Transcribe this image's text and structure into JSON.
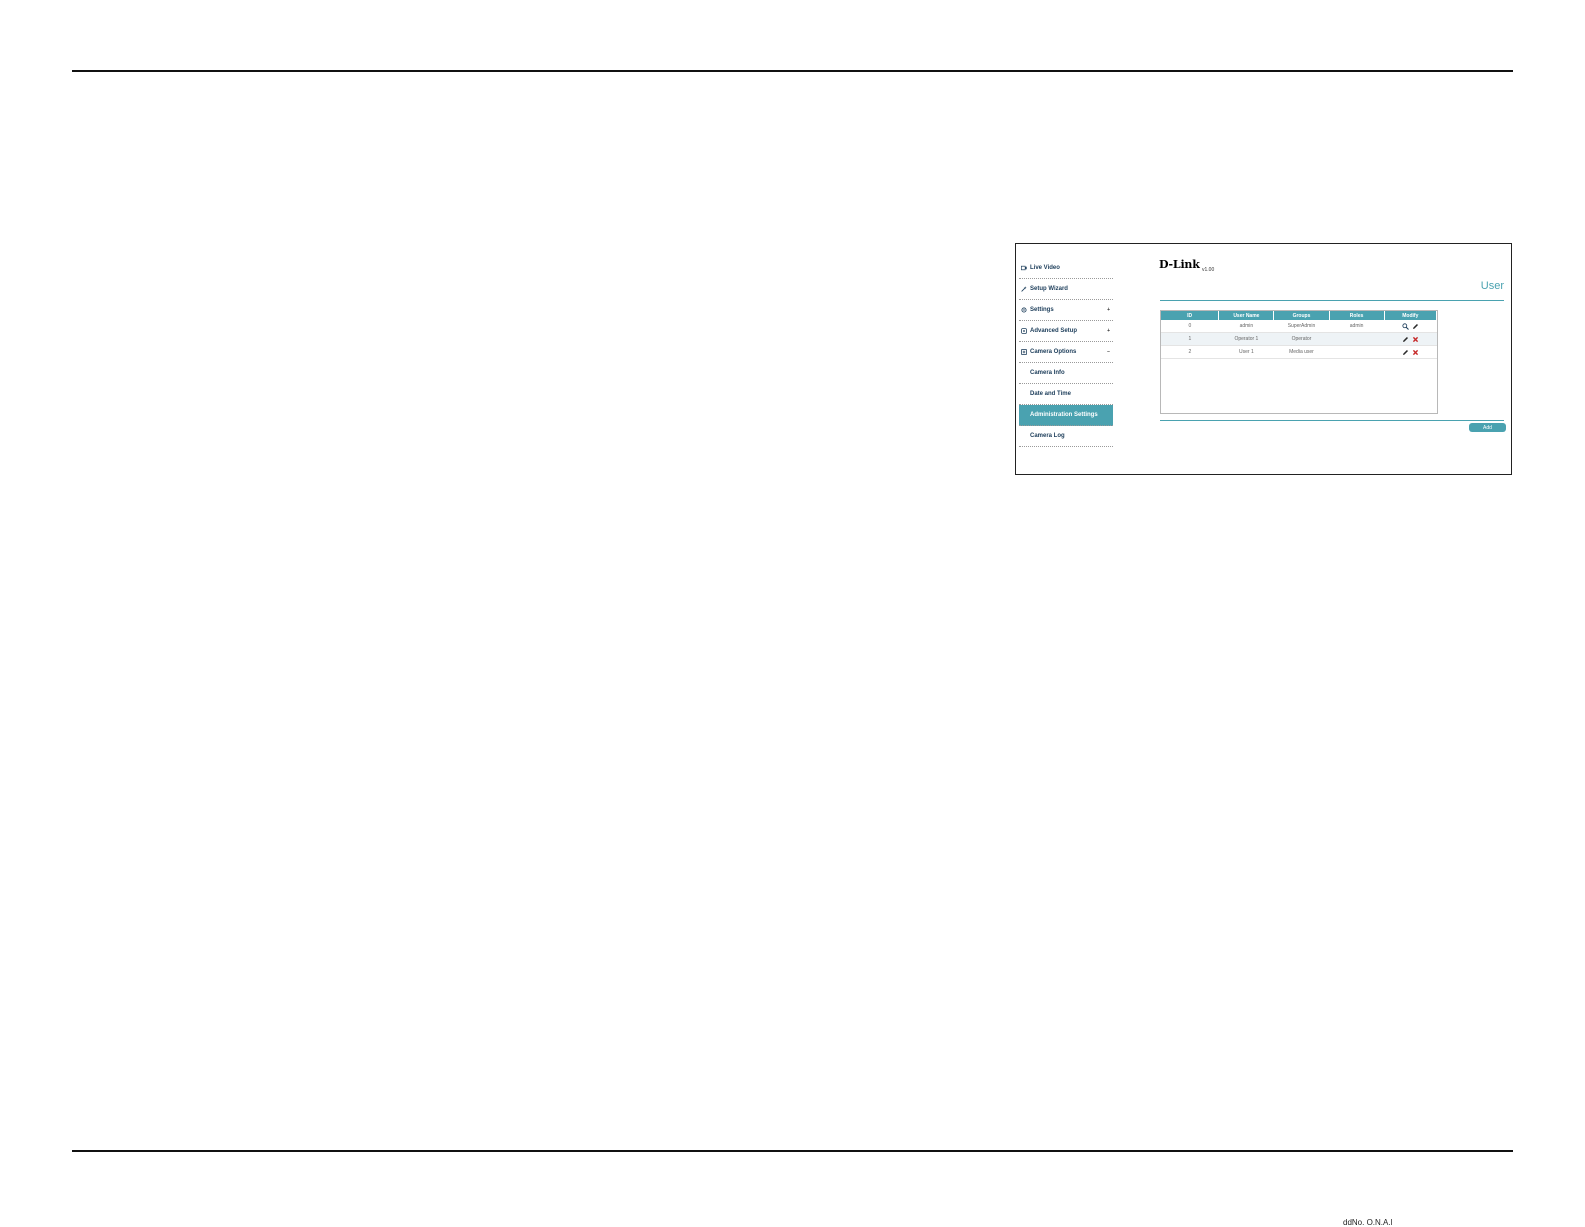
{
  "sidebar": {
    "items": [
      {
        "label": "Live Video",
        "icon": "video-icon"
      },
      {
        "label": "Setup Wizard",
        "icon": "wand-icon"
      },
      {
        "label": "Settings",
        "icon": "gear-icon",
        "chevron": "+"
      },
      {
        "label": "Advanced Setup",
        "icon": "advanced-icon",
        "chevron": "+"
      },
      {
        "label": "Camera Options",
        "icon": "camera-options-icon",
        "chevron": "−"
      }
    ],
    "subitems": [
      {
        "label": "Camera Info"
      },
      {
        "label": "Date and Time"
      },
      {
        "label": "Administration Settings",
        "active": true
      },
      {
        "label": "Camera Log"
      }
    ]
  },
  "header": {
    "logo": "D-Link",
    "version": "v1.00",
    "title": "User"
  },
  "table": {
    "columns": [
      "ID",
      "User Name",
      "Groups",
      "Roles",
      "Modify"
    ],
    "rows": [
      {
        "id": "0",
        "username": "admin",
        "group": "SuperAdmin",
        "role": "admin",
        "actions": [
          "view-icon",
          "edit-icon"
        ]
      },
      {
        "id": "1",
        "username": "Operator 1",
        "group": "Operator",
        "role": "",
        "actions": [
          "edit-icon",
          "delete-icon"
        ]
      },
      {
        "id": "2",
        "username": "User 1",
        "group": "Media user",
        "role": "",
        "actions": [
          "edit-icon",
          "delete-icon"
        ]
      }
    ]
  },
  "buttons": {
    "add_label": "Add"
  },
  "colors": {
    "accent": "#4aa2b0",
    "nav_text": "#1c3d5a",
    "delete": "#c62828"
  },
  "footer": {
    "text": "ddNo. O.N.A.l"
  }
}
